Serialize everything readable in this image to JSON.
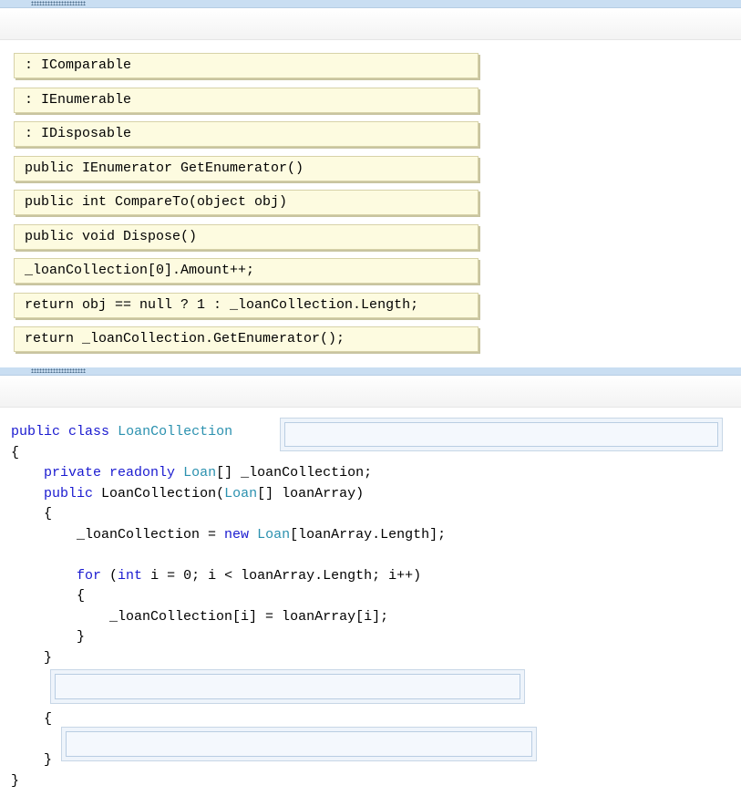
{
  "answer_options": [
    ": IComparable",
    ": IEnumerable",
    ": IDisposable",
    "public IEnumerator GetEnumerator()",
    "public int CompareTo(object obj)",
    "public void Dispose()",
    "_loanCollection[0].Amount++;",
    "return obj == null ? 1 : _loanCollection.Length;",
    "return _loanCollection.GetEnumerator();"
  ],
  "code": {
    "l1_kw1": "public",
    "l1_kw2": "class",
    "l1_type": "LoanCollection",
    "brace_open": "{",
    "brace_close": "}",
    "l3_kw1": "private",
    "l3_kw2": "readonly",
    "l3_type": "Loan",
    "l3_rest": "[] _loanCollection;",
    "l4_kw": "public",
    "l4_name": "LoanCollection(",
    "l4_type": "Loan",
    "l4_rest": "[] loanArray)",
    "l6_pre": "_loanCollection = ",
    "l6_kw": "new",
    "l6_type": "Loan",
    "l6_rest": "[loanArray.Length];",
    "l8_kw1": "for",
    "l8_mid": " (",
    "l8_kw2": "int",
    "l8_rest": " i = 0; i < loanArray.Length; i++)",
    "l10": "_loanCollection[i] = loanArray[i];"
  }
}
